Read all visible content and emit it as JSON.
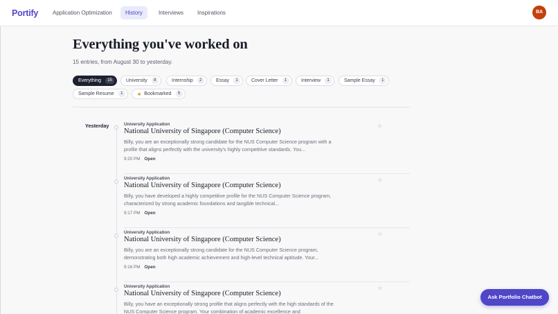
{
  "app": {
    "logo": "Portify",
    "avatar_initials": "BA"
  },
  "nav": {
    "items": [
      {
        "label": "Application Optimization",
        "active": false
      },
      {
        "label": "History",
        "active": true
      },
      {
        "label": "Interviews",
        "active": false
      },
      {
        "label": "Inspirations",
        "active": false
      }
    ]
  },
  "page": {
    "title": "Everything you've worked on",
    "subtitle": "15 entries, from August 30 to yesterday."
  },
  "filters": [
    {
      "label": "Everything",
      "count": "15",
      "active": true
    },
    {
      "label": "University",
      "count": "8"
    },
    {
      "label": "Internship",
      "count": "2"
    },
    {
      "label": "Essay",
      "count": "1"
    },
    {
      "label": "Cover Letter",
      "count": "1"
    },
    {
      "label": "Interview",
      "count": "1"
    },
    {
      "label": "Sample Essay",
      "count": "1"
    },
    {
      "label": "Sample Resume",
      "count": "1"
    },
    {
      "label": "Bookmarked",
      "count": "5",
      "icon": "star-icon"
    }
  ],
  "timeline": {
    "day_label": "Yesterday",
    "open_label": "Open",
    "entries": [
      {
        "category": "University Application",
        "title": "National University of Singapore (Computer Science)",
        "snippet": "Billy, you are an exceptionally strong candidate for the NUS Computer Science program with a profile that aligns perfectly with the university's highly competitive standards. You...",
        "time": "9:20 PM"
      },
      {
        "category": "University Application",
        "title": "National University of Singapore (Computer Science)",
        "snippet": "Billy, you have developed a highly competitive profile for the NUS Computer Science program, characterized by strong academic foundations and tangible technical...",
        "time": "9:17 PM"
      },
      {
        "category": "University Application",
        "title": "National University of Singapore (Computer Science)",
        "snippet": "Billy, you are an exceptionally strong candidate for the NUS Computer Science program, demonstrating both high academic achievement and high-level technical aptitude. Your...",
        "time": "9:16 PM"
      },
      {
        "category": "University Application",
        "title": "National University of Singapore (Computer Science)",
        "snippet": "Billy, you have an exceptionally strong profile that aligns perfectly with the high standards of the NUS Computer Science program. Your combination of academic excellence and",
        "time": ""
      }
    ]
  },
  "chatbot": {
    "label": "Ask Portfolio Chatbot"
  },
  "colors": {
    "accent": "#4f46c8",
    "avatar": "#c2410c",
    "active_chip": "#1c2030",
    "star": "#c8891b"
  }
}
